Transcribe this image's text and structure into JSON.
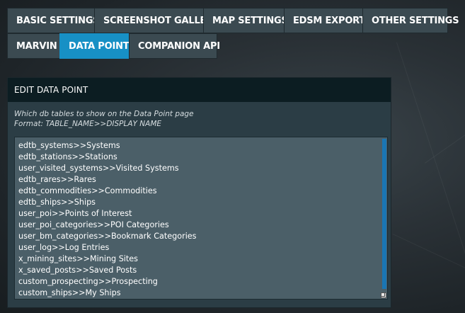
{
  "tabs_row1": [
    {
      "label": "BASIC SETTINGS",
      "active": false
    },
    {
      "label": "SCREENSHOT GALLERY",
      "active": false
    },
    {
      "label": "MAP SETTINGS",
      "active": false
    },
    {
      "label": "EDSM EXPORT",
      "active": false
    },
    {
      "label": "OTHER SETTINGS",
      "active": false
    }
  ],
  "tabs_row2": [
    {
      "label": "MARVIN",
      "active": false
    },
    {
      "label": "DATA POINT",
      "active": true
    },
    {
      "label": "COMPANION API",
      "active": false
    }
  ],
  "panel": {
    "title": "EDIT DATA POINT",
    "hint_line1": "Which db tables to show on the Data Point page",
    "hint_line2": "Format: TABLE_NAME>>DISPLAY NAME",
    "textarea_lines": [
      "edtb_systems>>Systems",
      "edtb_stations>>Stations",
      "user_visited_systems>>Visited Systems",
      "edtb_rares>>Rares",
      "edtb_commodities>>Commodities",
      "edtb_ships>>Ships",
      "user_poi>>Points of Interest",
      "user_poi_categories>>POI Categories",
      "user_bm_categories>>Bookmark Categories",
      "user_log>>Log Entries",
      "x_mining_sites>>Mining Sites",
      "x_saved_posts>>Saved Posts",
      "custom_prospecting>>Prospecting",
      "custom_ships>>My Ships"
    ]
  },
  "colors": {
    "tab_bg": "#3b4a51",
    "tab_active_bg": "#1790c5",
    "panel_header_bg": "#0c1d22",
    "textarea_bg": "#4b5f68",
    "scrollbar": "#1a76b4"
  }
}
